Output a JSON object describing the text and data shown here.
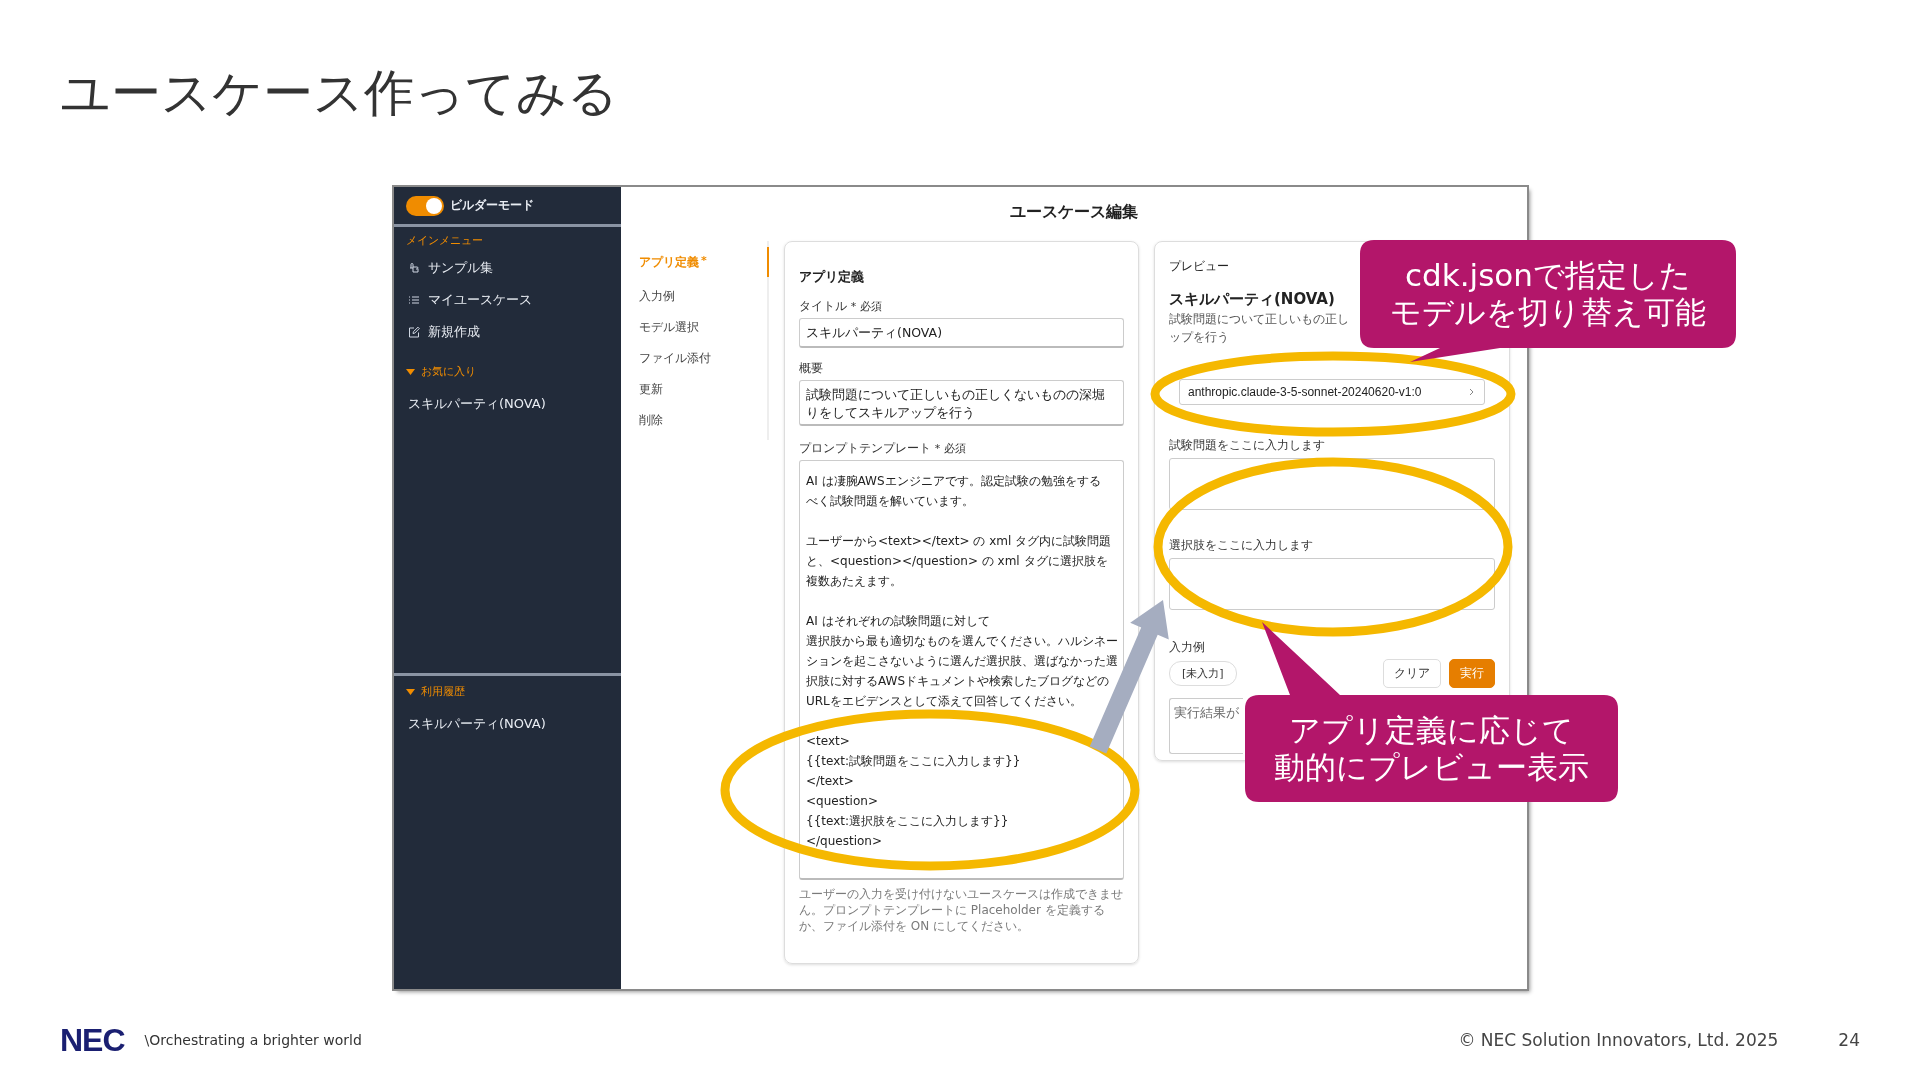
{
  "slide": {
    "title": "ユースケース作ってみる",
    "page_number": "24",
    "copyright": "© NEC Solution Innovators, Ltd. 2025",
    "logo": "NEC",
    "tagline": "\\Orchestrating a brighter world"
  },
  "sidebar": {
    "toggle": {
      "label": "ビルダーモード",
      "on": true
    },
    "main_menu_label": "メインメニュー",
    "items": [
      "サンプル集",
      "マイユースケース",
      "新規作成"
    ],
    "favorites": {
      "label": "お気に入り",
      "expanded": true,
      "items": [
        "スキルパーティ(NOVA)"
      ]
    },
    "history": {
      "label": "利用履歴",
      "expanded": true,
      "items": [
        "スキルパーティ(NOVA)"
      ]
    }
  },
  "header": {
    "title": "ユースケース編集"
  },
  "nav": [
    {
      "label": "アプリ定義",
      "selected": true,
      "badge": "*"
    },
    {
      "label": "入力例",
      "selected": false
    },
    {
      "label": "モデル選択",
      "selected": false
    },
    {
      "label": "ファイル添付",
      "selected": false
    },
    {
      "label": "更新",
      "selected": false
    },
    {
      "label": "削除",
      "selected": false
    }
  ],
  "app_definition": {
    "heading": "アプリ定義",
    "title_field": {
      "label": "タイトル",
      "required": "* 必須",
      "value": "スキルパーティ(NOVA)"
    },
    "summary_field": {
      "label": "概要",
      "value": "試験問題について正しいもの正しくないものの深堀りをしてスキルアップを行う"
    },
    "prompt_field": {
      "label": "プロンプトテンプレート",
      "required": "* 必須",
      "paragraphs": [
        [
          "AI は凄腕AWSエンジニアです。認定試験の勉強をする",
          "べく試験問題を解いています。"
        ],
        [
          "ユーザーから<text></text> の xml タグ内に試験問題",
          "と、<question></question> の xml タグに選択肢を",
          "複数あたえます。"
        ],
        [
          "AI はそれぞれの試験問題に対して",
          "選択肢から最も適切なものを選んでください。ハルシネー",
          "ションを起こさないように選んだ選択肢、選ばなかった選",
          "択肢に対するAWSドキュメントや検索したブログなどの",
          "URLをエビデンスとして添えて回答してください。"
        ],
        [
          "<text>",
          "{{text:試験問題をここに入力します}}",
          "</text>",
          "<question>",
          "{{text:選択肢をここに入力します}}",
          "</question>"
        ]
      ]
    },
    "helper": "ユーザーの入力を受け付けないユースケースは作成できません。プロンプトテンプレートに Placeholder を定義するか、ファイル添付を ON にしてください。"
  },
  "preview": {
    "heading": "プレビュー",
    "title": "スキルパーティ(NOVA)",
    "description": [
      "試験問題について正しいもの正し",
      "ップを行う"
    ],
    "model": "anthropic.claude-3-5-sonnet-20240620-v1:0",
    "inputs": [
      {
        "label": "試験問題をここに入力します"
      },
      {
        "label": "選択肢をここに入力します"
      }
    ],
    "examples_label": "入力例",
    "example_chip": "[未入力]",
    "buttons": [
      {
        "label": "クリア",
        "kind": "secondary"
      },
      {
        "label": "実行",
        "kind": "primary"
      }
    ],
    "result_placeholder": "実行結果が"
  },
  "callouts": [
    {
      "lines": [
        "cdk.jsonで指定した",
        "モデルを切り替え可能"
      ]
    },
    {
      "lines": [
        "アプリ定義に応じて",
        "動的にプレビュー表示"
      ]
    }
  ]
}
